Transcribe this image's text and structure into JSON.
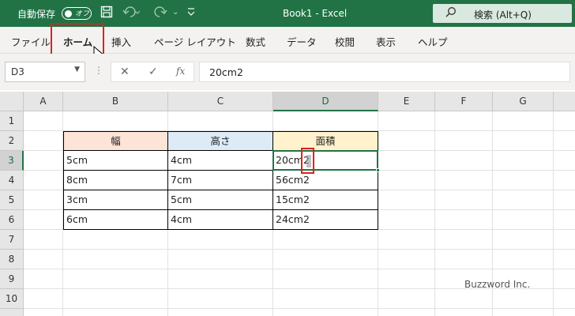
{
  "titlebar": {
    "autosave_label": "自動保存",
    "toggle_state": "オフ",
    "title": "Book1 - Excel",
    "search_label": "検索 (Alt+Q)",
    "bg_color": "#217346"
  },
  "ribbon": {
    "tabs": [
      "ファイル",
      "ホーム",
      "挿入",
      "ページ レイアウト",
      "数式",
      "データ",
      "校閲",
      "表示",
      "ヘルプ"
    ],
    "active_tab": "ホーム"
  },
  "formula_bar": {
    "name_box": "D3",
    "cancel_icon": "✕",
    "enter_icon": "✓",
    "fx_label": "fx",
    "value": "20cm2"
  },
  "sheet": {
    "columns": [
      "A",
      "B",
      "C",
      "D",
      "E",
      "F",
      "G"
    ],
    "rows": [
      "1",
      "2",
      "3",
      "4",
      "5",
      "6",
      "7",
      "8",
      "9",
      "10"
    ],
    "selected_column": "D",
    "selected_row": "3",
    "table": {
      "headers": [
        "幅",
        "高さ",
        "面積"
      ],
      "header_colors": [
        "#fce4d6",
        "#ddebf7",
        "#fff2cc"
      ],
      "rows": [
        [
          "5cm",
          "4cm",
          "20cm2"
        ],
        [
          "8cm",
          "7cm",
          "56cm2"
        ],
        [
          "3cm",
          "5cm",
          "15cm2"
        ],
        [
          "6cm",
          "4cm",
          "24cm2"
        ]
      ]
    }
  },
  "watermark": "Buzzword Inc."
}
